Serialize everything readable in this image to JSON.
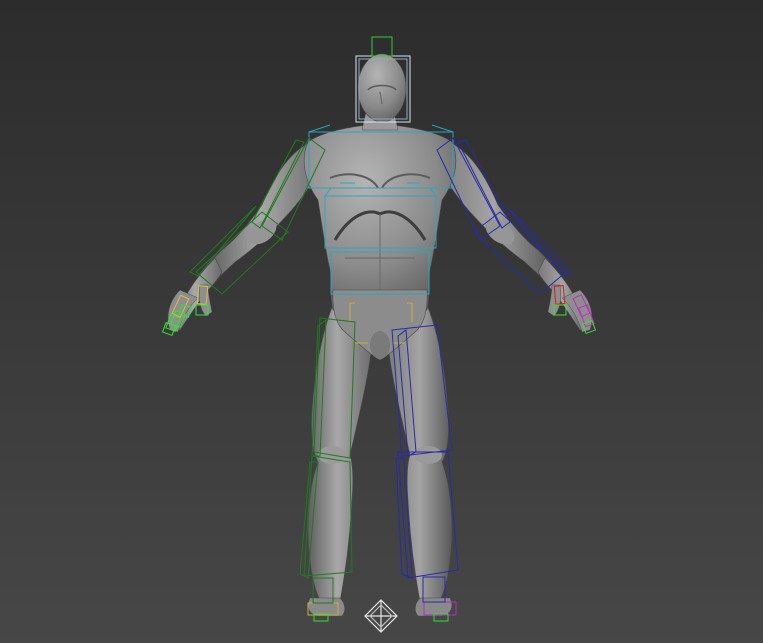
{
  "viewport": {
    "view": "front",
    "shading": "smooth",
    "colors": {
      "background_top": "#2c2c2c",
      "background_bottom": "#474747",
      "mesh": "#8e8e8e",
      "mesh_highlight": "#bdbdbd",
      "mesh_shadow": "#3c3c3c",
      "bone_head": "#d8e4f0",
      "bone_spine": "#2aa6c2",
      "bone_left_limb": "#1f7a1f",
      "bone_right_limb": "#2a2aa8",
      "bone_finger_green": "#38e038",
      "bone_finger_yellow": "#d8c040",
      "bone_finger_red": "#d02020",
      "bone_finger_magenta": "#c030c0",
      "bone_toe_green": "#30e030",
      "bone_toe_magenta": "#b030c0",
      "bone_pelvis": "#c8b040",
      "gizmo": "#e8e8e8"
    },
    "objects": [
      {
        "name": "humanoid-mesh",
        "kind": "mesh"
      },
      {
        "name": "biped-rig",
        "kind": "skeleton"
      },
      {
        "name": "transform-gizmo",
        "kind": "gizmo"
      }
    ]
  }
}
